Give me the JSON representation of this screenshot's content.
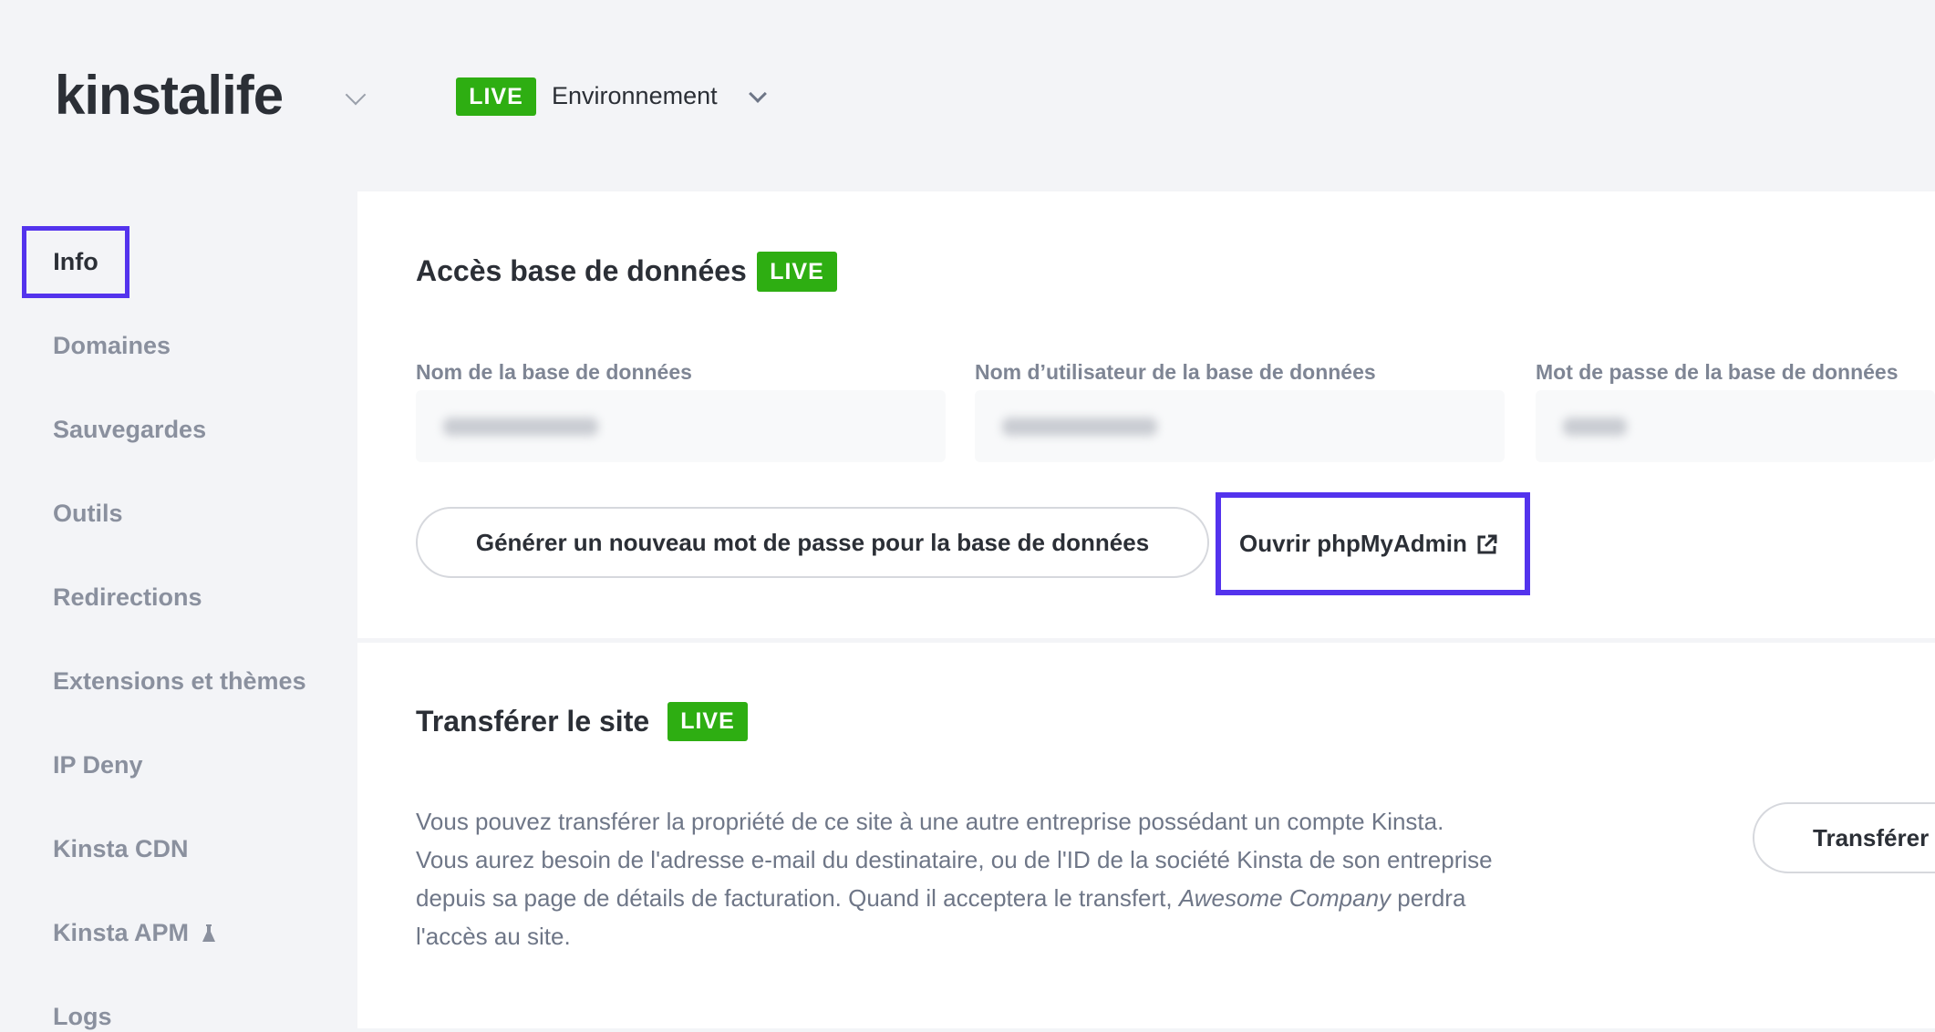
{
  "header": {
    "site_name": "kinstalife",
    "env_badge": "LIVE",
    "env_label": "Environnement"
  },
  "sidebar": {
    "items": [
      {
        "label": "Info",
        "active": true
      },
      {
        "label": "Domaines"
      },
      {
        "label": "Sauvegardes"
      },
      {
        "label": "Outils"
      },
      {
        "label": "Redirections"
      },
      {
        "label": "Extensions et thèmes"
      },
      {
        "label": "IP Deny"
      },
      {
        "label": "Kinsta CDN"
      },
      {
        "label": "Kinsta APM",
        "icon": "flask-icon"
      },
      {
        "label": "Logs"
      }
    ]
  },
  "db": {
    "title": "Accès base de données",
    "badge": "LIVE",
    "fields": [
      {
        "label": "Nom de la base de données"
      },
      {
        "label": "Nom d’utilisateur de la base de données"
      },
      {
        "label": "Mot de passe de la base de données"
      }
    ],
    "generate_button": "Générer un nouveau mot de passe pour la base de données",
    "phpmyadmin_button": "Ouvrir phpMyAdmin"
  },
  "transfer": {
    "title": "Transférer le site",
    "badge": "LIVE",
    "text1": "Vous pouvez transférer la propriété de ce site à une autre entreprise possédant un compte Kinsta. Vous aurez besoin de l'adresse e-mail du destinataire, ou de l'ID de la société Kinsta de son entreprise depuis sa page de détails de facturation. Quand il acceptera le transfert, ",
    "company": "Awesome Company",
    "text2": " perdra l'accès au site.",
    "button": "Transférer"
  },
  "colors": {
    "live": "#2eae12",
    "highlight": "#5333ed"
  }
}
